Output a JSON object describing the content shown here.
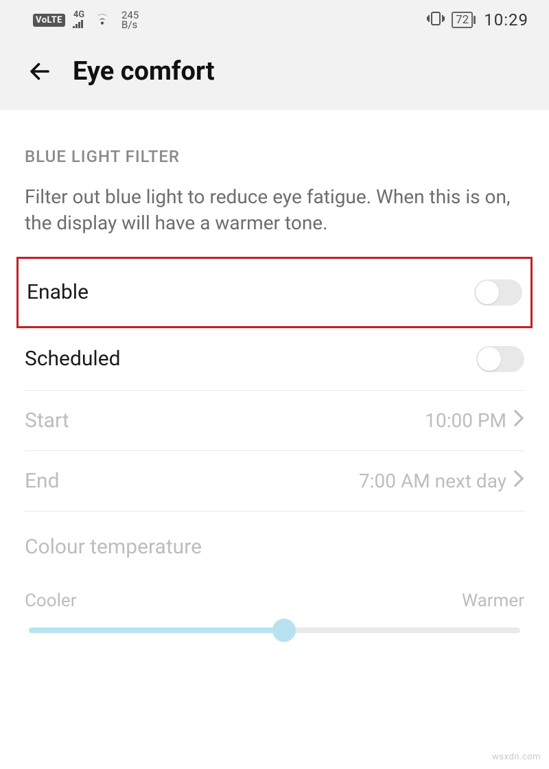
{
  "status": {
    "volte": "VoLTE",
    "network_gen": "4G",
    "data_rate_top": "245",
    "data_rate_bottom": "B/s",
    "battery_percent": "72",
    "time": "10:29"
  },
  "header": {
    "title": "Eye comfort"
  },
  "section": {
    "title": "BLUE LIGHT FILTER",
    "description": "Filter out blue light to reduce eye fatigue. When this is on, the display will have a warmer tone."
  },
  "rows": {
    "enable": {
      "label": "Enable"
    },
    "scheduled": {
      "label": "Scheduled"
    },
    "start": {
      "label": "Start",
      "value": "10:00 PM"
    },
    "end": {
      "label": "End",
      "value": "7:00 AM next day"
    }
  },
  "slider": {
    "title": "Colour temperature",
    "left_label": "Cooler",
    "right_label": "Warmer",
    "position_percent": 52
  },
  "watermark": "wsxdn.com"
}
